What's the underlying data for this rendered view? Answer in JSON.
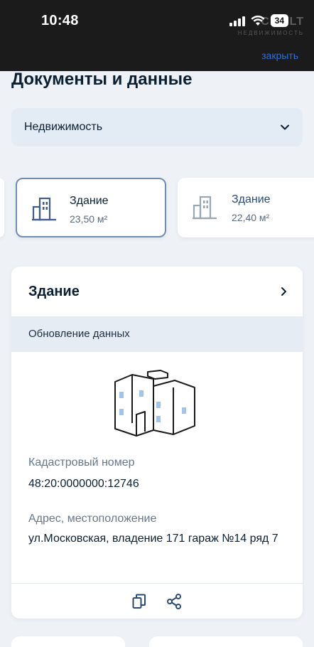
{
  "status_bar": {
    "time": "10:48",
    "battery": "34",
    "watermark": "CITYLT",
    "watermark_sub": "НЕДВИЖИМОСТЬ"
  },
  "header": {
    "close_label": "закрыть",
    "title": "Документы и данные"
  },
  "category_select": {
    "value": "Недвижимость"
  },
  "objects": [
    {
      "title": "Здание",
      "area": "23,50 м²",
      "selected": true
    },
    {
      "title": "Здание",
      "area": "22,40 м²",
      "selected": false
    }
  ],
  "detail": {
    "title": "Здание",
    "update_label": "Обновление данных",
    "cadastral_label": "Кадастровый номер",
    "cadastral_value": "48:20:0000000:12746",
    "address_label": "Адрес, местоположение",
    "address_value": "ул.Московская, владение 171 гараж №14 ряд 7"
  },
  "colors": {
    "accent": "#2f6fd8",
    "selected_border": "#6d8db4",
    "background": "#eef2f7"
  },
  "icons": [
    "signal-icon",
    "wifi-icon",
    "battery-icon",
    "chevron-down-icon",
    "building-icon",
    "chevron-right-icon",
    "copy-icon",
    "share-icon"
  ]
}
